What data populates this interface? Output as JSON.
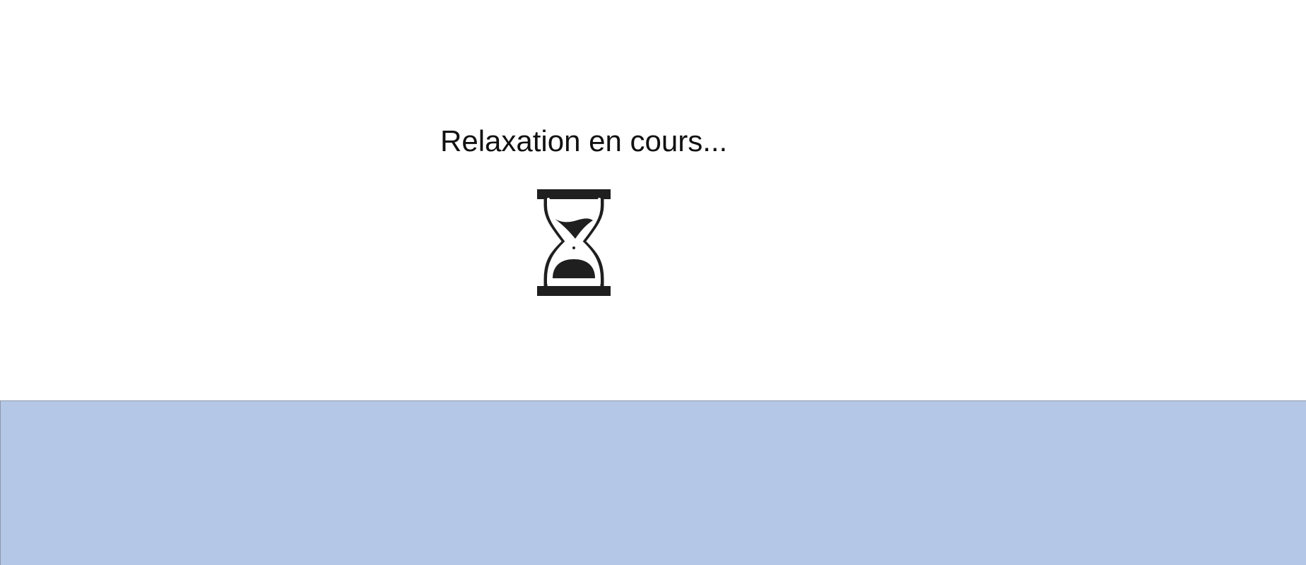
{
  "status": {
    "text": "Relaxation en cours..."
  },
  "icons": {
    "loading": "hourglass-icon"
  },
  "colors": {
    "background": "#ffffff",
    "text": "#111111",
    "icon": "#1f1f1f",
    "panel": "#b4c7e7"
  }
}
